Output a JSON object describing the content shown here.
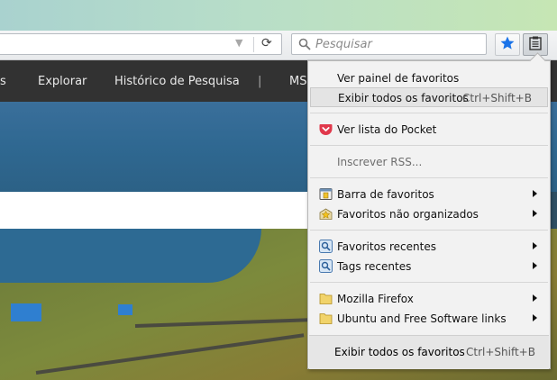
{
  "search": {
    "placeholder": "Pesquisar"
  },
  "nav": {
    "items": [
      "s",
      "Explorar",
      "Histórico de Pesquisa",
      "|",
      "MS"
    ]
  },
  "menu": {
    "items": [
      {
        "label": "Ver painel de favoritos",
        "shortcut": ""
      },
      {
        "label": "Exibir todos os favoritos",
        "shortcut": "Ctrl+Shift+B"
      },
      {
        "label": "Ver lista do Pocket",
        "shortcut": ""
      },
      {
        "label": "Inscrever RSS...",
        "shortcut": ""
      },
      {
        "label": "Barra de favoritos",
        "shortcut": ""
      },
      {
        "label": "Favoritos não organizados",
        "shortcut": ""
      },
      {
        "label": "Favoritos recentes",
        "shortcut": ""
      },
      {
        "label": "Tags recentes",
        "shortcut": ""
      },
      {
        "label": "Mozilla Firefox",
        "shortcut": ""
      },
      {
        "label": "Ubuntu and Free Software links",
        "shortcut": ""
      }
    ],
    "footer": {
      "label": "Exibir todos os favoritos",
      "shortcut": "Ctrl+Shift+B"
    }
  },
  "colors": {
    "accent": "#1a73e8",
    "pocket": "#e0384b",
    "navbar": "#323232"
  }
}
